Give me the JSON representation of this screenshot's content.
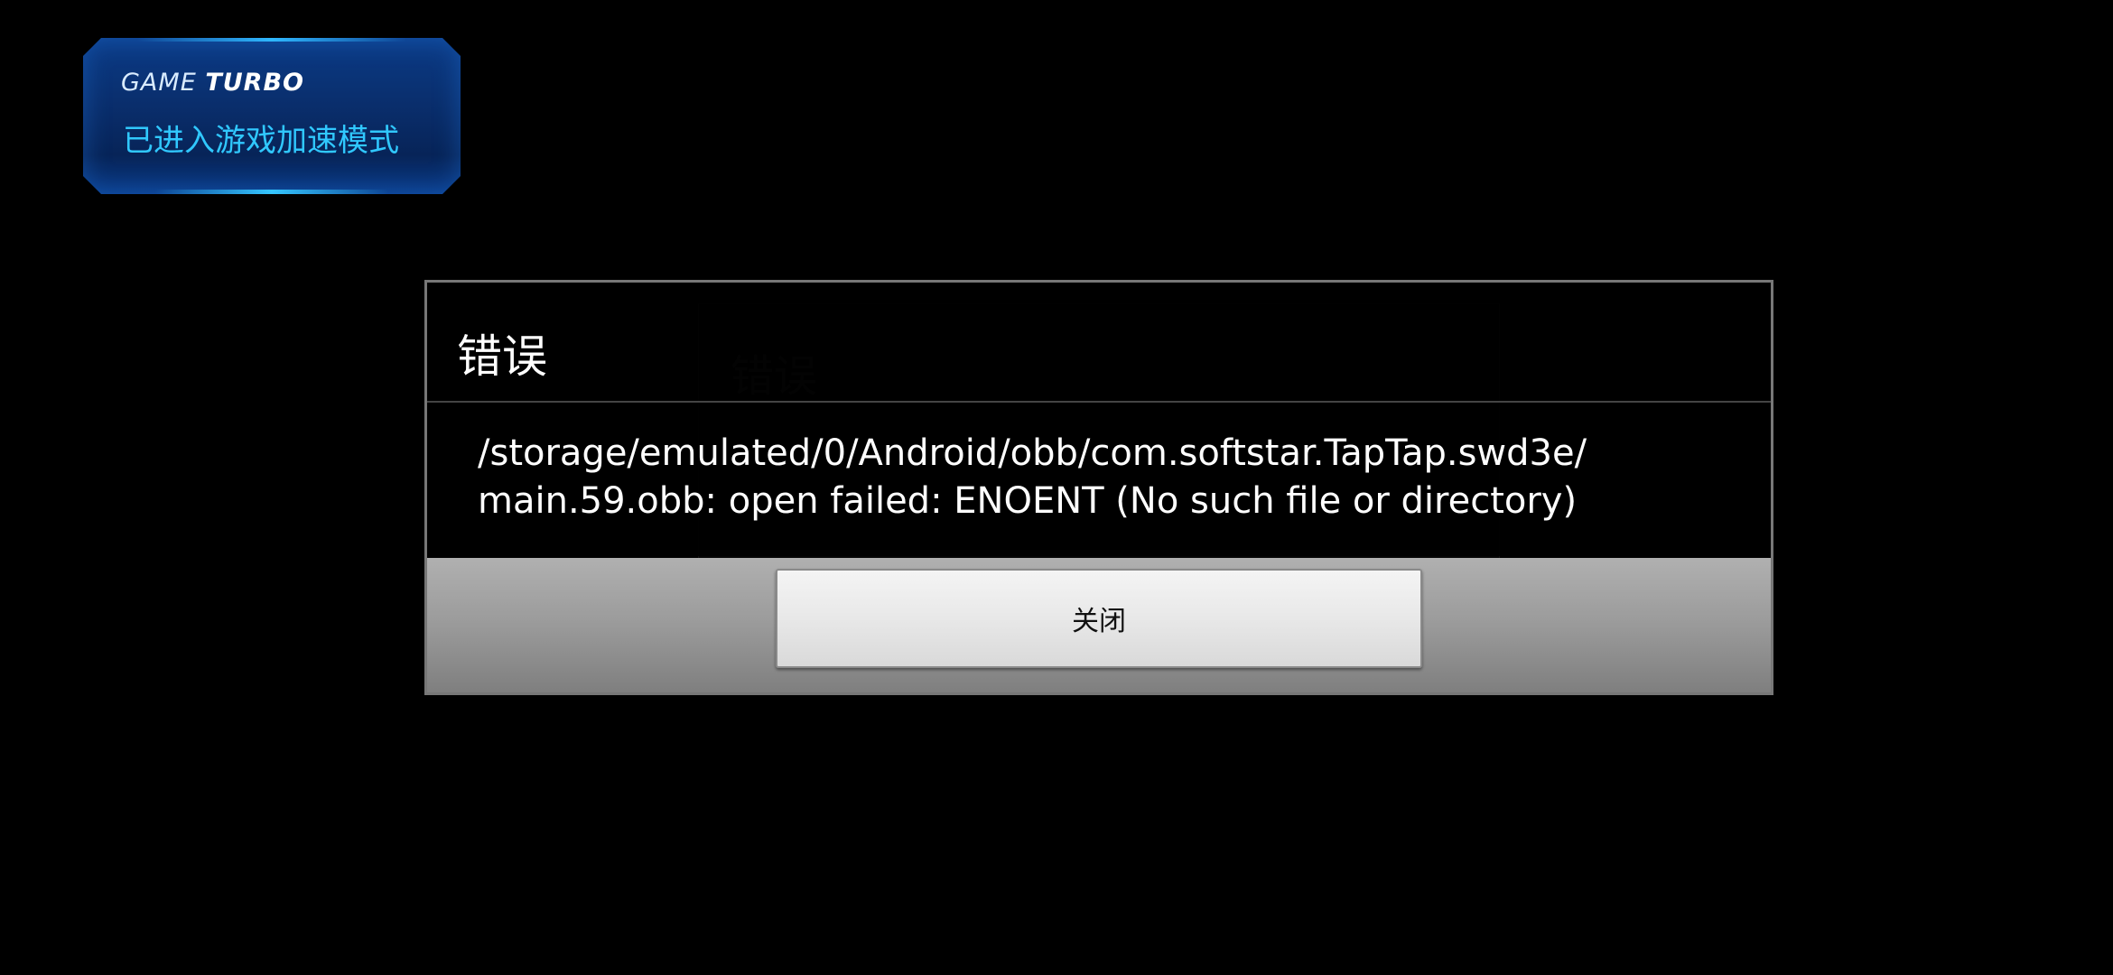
{
  "turbo_toast": {
    "brand_light": "GAME",
    "brand_bold": "TURBO",
    "status": "已进入游戏加速模式"
  },
  "ghost_dialog": {
    "title": "错误"
  },
  "error_dialog": {
    "title": "错误",
    "message_line1": "/storage/emulated/0/Android/obb/com.softstar.TapTap.swd3e/",
    "message_line2": "main.59.obb: open failed: ENOENT (No such file or directory)",
    "close_label": "关闭"
  },
  "colors": {
    "background": "#000000",
    "toast_accent": "#30c8ff",
    "toast_bg": "#0a2f6e",
    "dialog_border": "#777777",
    "footer_gray": "#9a9a9a"
  }
}
